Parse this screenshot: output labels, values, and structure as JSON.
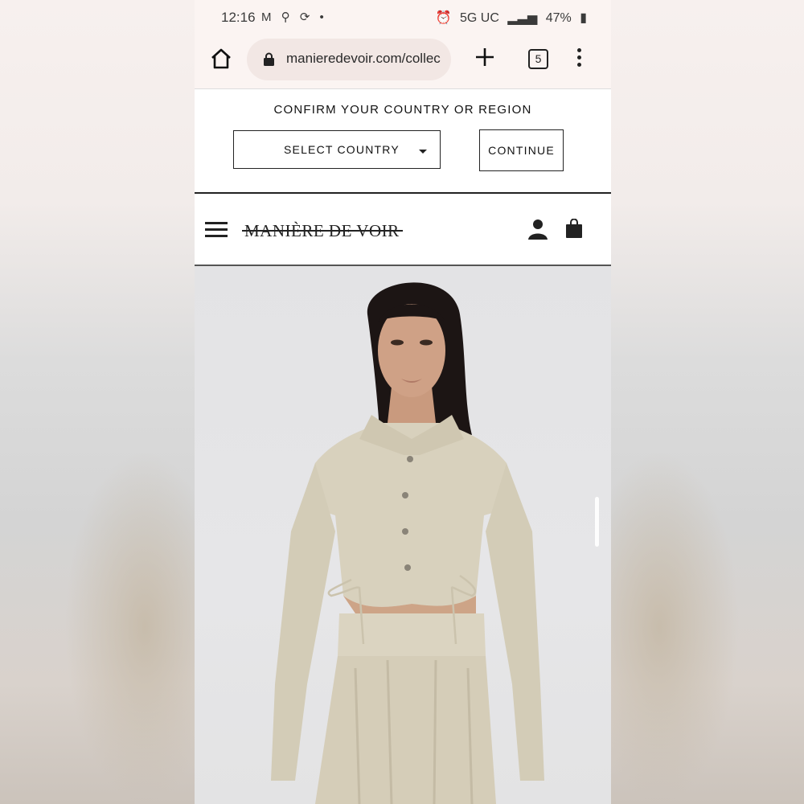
{
  "status_bar": {
    "time": "12:16",
    "left_icons": "M ⚲ ⟳ •",
    "network": "5G UC",
    "battery": "47%"
  },
  "browser": {
    "url": "manieredevoir.com/collec",
    "tabs_count": "5"
  },
  "country_banner": {
    "title": "CONFIRM YOUR COUNTRY OR REGION",
    "select_label": "SELECT COUNTRY",
    "continue_label": "CONTINUE"
  },
  "site_header": {
    "logo": "MANIÈRE DE VOIR"
  },
  "colors": {
    "outfit": "#d8d1bd",
    "hair": "#1c1514",
    "skin": "#cfa186",
    "image_bg": "#e4e4e6"
  },
  "icons": [
    "home-icon",
    "lock-icon",
    "plus-icon",
    "tabs-icon",
    "overflow-menu-icon",
    "hamburger-icon",
    "account-icon",
    "shopping-bag-icon"
  ]
}
